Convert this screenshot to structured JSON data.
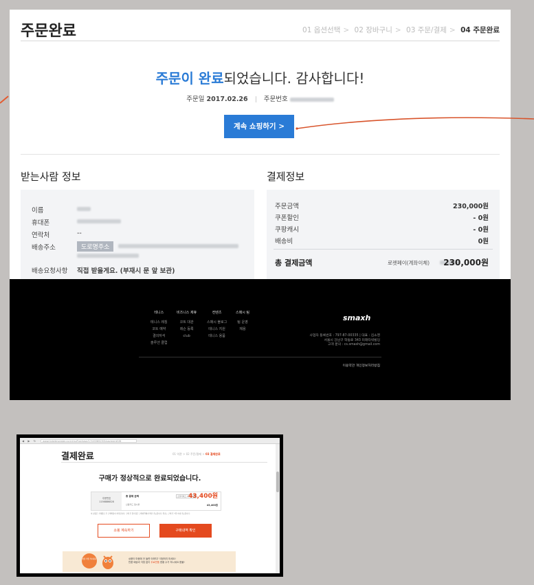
{
  "main": {
    "title": "주문완료",
    "steps": [
      {
        "label": "01 옵션선택"
      },
      {
        "label": "02 장바구니"
      },
      {
        "label": "03 주문/결제"
      },
      {
        "label": "04 주문완료"
      }
    ],
    "headline_highlight": "주문이 완료",
    "headline_rest": "되었습니다. 감사합니다!",
    "order_date_label": "주문일",
    "order_date": "2017.02.26",
    "order_no_label": "주문번호",
    "continue_button": "계속 쇼핑하기 >"
  },
  "recipient": {
    "title": "받는사람 정보",
    "name_label": "이름",
    "phone_label": "휴대폰",
    "contact_label": "연락처",
    "contact_value": "--",
    "address_label": "배송주소",
    "address_badge": "도로명주소",
    "request_label": "배송요청사항",
    "request_value": "직접 받을게요. (부재시 문 앞 보관)"
  },
  "payment": {
    "title": "결제정보",
    "rows": [
      {
        "label": "주문금액",
        "value": "230,000원"
      },
      {
        "label": "쿠폰할인",
        "value": "- 0원"
      },
      {
        "label": "쿠팡캐시",
        "value": "- 0원"
      },
      {
        "label": "배송비",
        "value": "0원"
      }
    ],
    "total_label": "총 결제금액",
    "total_method": "로켓페이(계좌이체)",
    "total_value": "230,000원"
  },
  "footer": {
    "cols": [
      {
        "head": "테니스",
        "items": [
          "테니스 레칭",
          "코트 예약",
          "결의자석",
          "솔루션 클럽"
        ]
      },
      {
        "head": "비즈니스 제휴",
        "items": [
          "코트 대관",
          "레슨 등록",
          "club"
        ]
      },
      {
        "head": "컨텐츠",
        "items": [
          "스매시 블로그",
          "테니스 지원",
          "테니스 용품"
        ]
      },
      {
        "head": "스매시 팀",
        "items": [
          "팀 운영",
          "채용"
        ]
      }
    ],
    "logo": "smaxh",
    "corp_lines": [
      "사업자 등록번호 : 797-87-00335 | 대표 : 김소영",
      "서울시 강남구 학동로 343 미래타워빌딩",
      "고객 문의 : cs.smash@gmail.com"
    ],
    "links": "이용약관    개인정보처리방침"
  },
  "sub": {
    "url": "www.ticketmonster.co.kr/rsvPurchase/17/4936929/5/paymentGift",
    "title": "결제완료",
    "steps_prefix": "01 약관 > 02 주문/결제 >",
    "steps_current": "03 결제완료",
    "done_text": "구매가 정상적으로 완료되었습니다.",
    "order_label": "주문번호",
    "order_no": "1156886828",
    "total_label": "총 결제 금액",
    "tag": "소셜커머스 43,400원",
    "amount": "43,400원",
    "sub_label": "신용카드 일시불",
    "sub_amount": "43,400원",
    "note": "이 상품은 거래종료 후 구매확정이 처리됩니다. 구매 후 영수증은 구매내역에서 확인 가능합니다. 취소는 구매 후 7일 이내 가능합니다.",
    "btn_continue": "쇼핑 계속하기",
    "btn_history": "구매내역 확인",
    "banner_badge": "선물 마일 적어지다",
    "banner_line1": "상품이 마음에 안 들면 어쩌지? 걱정하지 마세요!",
    "banner_line2_a": "반품 배송비 걱정 없이",
    "banner_line2_hl": "무료반품",
    "banner_line2_b": "현황 수가 하시세요 환불!"
  }
}
